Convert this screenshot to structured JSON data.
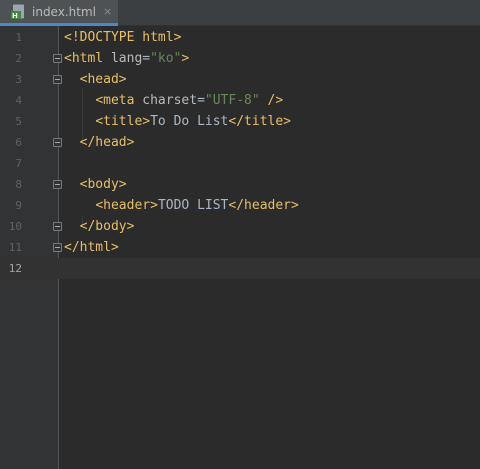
{
  "tab": {
    "filename": "index.html",
    "close_glyph": "×",
    "icon": "html-file-icon"
  },
  "colors": {
    "background": "#2b2b2b",
    "gutter": "#313335",
    "tag": "#e8bf6a",
    "attribute": "#bababa",
    "string": "#6a8759",
    "text": "#a9b7c6",
    "accent": "#4a88c7"
  },
  "editor": {
    "current_line": 12,
    "lines": [
      {
        "number": "1",
        "tokens": [
          [
            "tag",
            "<!DOCTYPE html>"
          ]
        ]
      },
      {
        "number": "2",
        "tokens": [
          [
            "tag",
            "<html "
          ],
          [
            "attr",
            "lang"
          ],
          [
            "txt",
            "="
          ],
          [
            "str",
            "\"ko\""
          ],
          [
            "tag",
            ">"
          ]
        ]
      },
      {
        "number": "3",
        "tokens": [
          [
            "txt",
            "  "
          ],
          [
            "tag",
            "<head>"
          ]
        ]
      },
      {
        "number": "4",
        "tokens": [
          [
            "txt",
            "    "
          ],
          [
            "tag",
            "<meta "
          ],
          [
            "attr",
            "charset"
          ],
          [
            "txt",
            "="
          ],
          [
            "str",
            "\"UTF-8\""
          ],
          [
            "tag",
            " />"
          ]
        ]
      },
      {
        "number": "5",
        "tokens": [
          [
            "txt",
            "    "
          ],
          [
            "tag",
            "<title>"
          ],
          [
            "txt",
            "To Do List"
          ],
          [
            "tag",
            "</title>"
          ]
        ]
      },
      {
        "number": "6",
        "tokens": [
          [
            "txt",
            "  "
          ],
          [
            "tag",
            "</head>"
          ]
        ]
      },
      {
        "number": "7",
        "tokens": []
      },
      {
        "number": "8",
        "tokens": [
          [
            "txt",
            "  "
          ],
          [
            "tag",
            "<body>"
          ]
        ]
      },
      {
        "number": "9",
        "tokens": [
          [
            "txt",
            "    "
          ],
          [
            "tag",
            "<header>"
          ],
          [
            "txt",
            "TODO LIST"
          ],
          [
            "tag",
            "</header>"
          ]
        ]
      },
      {
        "number": "10",
        "tokens": [
          [
            "txt",
            "  "
          ],
          [
            "tag",
            "</body>"
          ]
        ]
      },
      {
        "number": "11",
        "tokens": [
          [
            "tag",
            "</html>"
          ]
        ]
      },
      {
        "number": "12",
        "tokens": []
      }
    ]
  }
}
